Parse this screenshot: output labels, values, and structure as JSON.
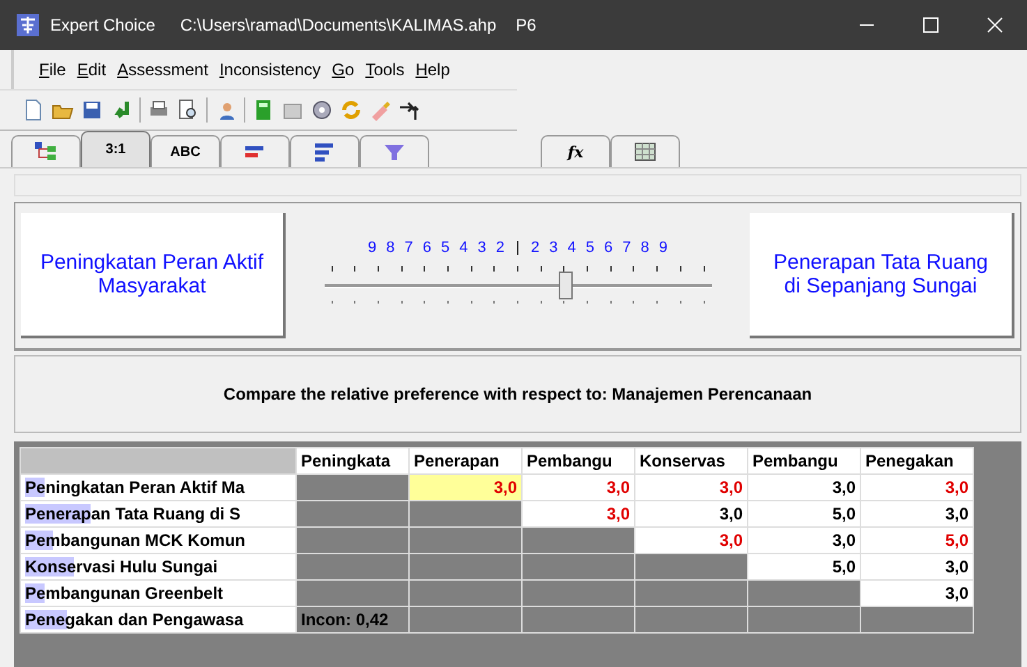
{
  "window": {
    "title": "Expert Choice",
    "path": "C:\\Users\\ramad\\Documents\\KALIMAS.ahp",
    "node": "P6"
  },
  "menu": [
    {
      "label": "File"
    },
    {
      "label": "Edit"
    },
    {
      "label": "Assessment"
    },
    {
      "label": "Inconsistency"
    },
    {
      "label": "Go"
    },
    {
      "label": "Tools"
    },
    {
      "label": "Help"
    }
  ],
  "tabs": [
    {
      "kind": "icon",
      "selected": false
    },
    {
      "kind": "text",
      "label": "3:1",
      "selected": true
    },
    {
      "kind": "text",
      "label": "ABC",
      "selected": false
    },
    {
      "kind": "icon",
      "selected": false
    },
    {
      "kind": "icon",
      "selected": false
    },
    {
      "kind": "icon",
      "selected": false
    },
    {
      "kind": "text",
      "label": "fx",
      "selected": false
    },
    {
      "kind": "icon",
      "selected": false
    }
  ],
  "comparison": {
    "left": "Peningkatan Peran Aktif Masyarakat",
    "right": "Penerapan Tata Ruang di Sepanjang Sungai",
    "scale": [
      "9",
      "8",
      "7",
      "6",
      "5",
      "4",
      "3",
      "2",
      "2",
      "3",
      "4",
      "5",
      "6",
      "7",
      "8",
      "9"
    ],
    "level": 0.625
  },
  "prompt": "Compare the relative preference with respect to: Manajemen Perencanaan",
  "matrix": {
    "columns": [
      "Peningkata",
      "Penerapan",
      "Pembangu",
      "Konservas",
      "Pembangu",
      "Penegakan"
    ],
    "rows": [
      {
        "label": "Peningkatan Peran Aktif Ma",
        "level": 0.07,
        "cells": [
          {
            "kind": "blank"
          },
          {
            "kind": "value",
            "text": "3,0",
            "inverted": true,
            "selected": true
          },
          {
            "kind": "value",
            "text": "3,0",
            "inverted": true,
            "selected": false
          },
          {
            "kind": "value",
            "text": "3,0",
            "inverted": true,
            "selected": false
          },
          {
            "kind": "value",
            "text": "3,0",
            "inverted": false,
            "selected": false
          },
          {
            "kind": "value",
            "text": "3,0",
            "inverted": true,
            "selected": false
          }
        ]
      },
      {
        "label": "Penerapan Tata Ruang di S",
        "level": 0.24,
        "cells": [
          {
            "kind": "blank"
          },
          {
            "kind": "blank"
          },
          {
            "kind": "value",
            "text": "3,0",
            "inverted": true,
            "selected": false
          },
          {
            "kind": "value",
            "text": "3,0",
            "inverted": false,
            "selected": false
          },
          {
            "kind": "value",
            "text": "5,0",
            "inverted": false,
            "selected": false
          },
          {
            "kind": "value",
            "text": "3,0",
            "inverted": false,
            "selected": false
          }
        ]
      },
      {
        "label": "Pembangunan MCK Komun",
        "level": 0.1,
        "cells": [
          {
            "kind": "blank"
          },
          {
            "kind": "blank"
          },
          {
            "kind": "blank"
          },
          {
            "kind": "value",
            "text": "3,0",
            "inverted": true,
            "selected": false
          },
          {
            "kind": "value",
            "text": "3,0",
            "inverted": false,
            "selected": false
          },
          {
            "kind": "value",
            "text": "5,0",
            "inverted": true,
            "selected": false
          }
        ]
      },
      {
        "label": "Konservasi Hulu Sungai",
        "level": 0.18,
        "cells": [
          {
            "kind": "blank"
          },
          {
            "kind": "blank"
          },
          {
            "kind": "blank"
          },
          {
            "kind": "blank"
          },
          {
            "kind": "value",
            "text": "5,0",
            "inverted": false,
            "selected": false
          },
          {
            "kind": "value",
            "text": "3,0",
            "inverted": false,
            "selected": false
          }
        ]
      },
      {
        "label": "Pembangunan Greenbelt",
        "level": 0.07,
        "cells": [
          {
            "kind": "blank"
          },
          {
            "kind": "blank"
          },
          {
            "kind": "blank"
          },
          {
            "kind": "blank"
          },
          {
            "kind": "blank"
          },
          {
            "kind": "value",
            "text": "3,0",
            "inverted": false,
            "selected": false
          }
        ]
      },
      {
        "label": "Penegakan dan Pengawasa",
        "level": 0.15,
        "cells": [
          {
            "kind": "note",
            "text": "Incon: 0,42"
          },
          {
            "kind": "blank"
          },
          {
            "kind": "blank"
          },
          {
            "kind": "blank"
          },
          {
            "kind": "blank"
          },
          {
            "kind": "blank"
          }
        ]
      }
    ]
  }
}
